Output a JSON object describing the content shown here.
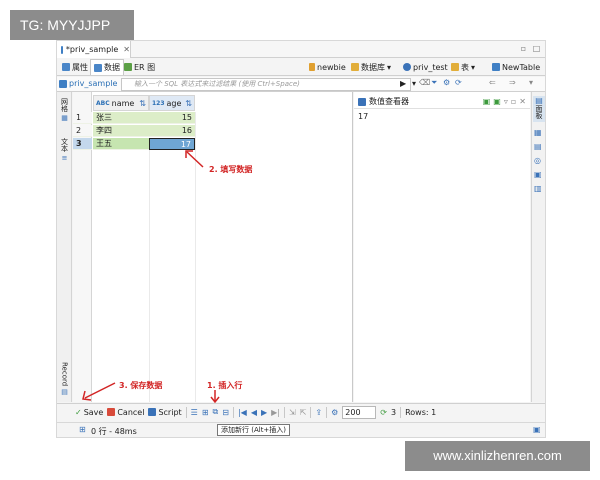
{
  "watermark_top": "TG: MYYJJPP",
  "watermark_bottom": "www.xinlizhenren.com",
  "editor_tab": {
    "title": "*priv_sample",
    "close": "✕"
  },
  "subtabs": [
    {
      "label": "属性"
    },
    {
      "label": "数据"
    },
    {
      "label": "ER 图"
    }
  ],
  "right_tools": {
    "connection": "newbie",
    "database_label": "数据库",
    "schema": "priv_test",
    "table_label": "表",
    "new_table": "NewTable"
  },
  "filter": {
    "table_name": "priv_sample",
    "placeholder": "输入一个 SQL 表达式来过滤结果 (使用 Ctrl+Space)"
  },
  "left_vtabs": {
    "grid": "网格",
    "text": "文本",
    "record": "Record"
  },
  "grid": {
    "columns": [
      {
        "type": "ABC",
        "name": "name"
      },
      {
        "type": "123",
        "name": "age"
      }
    ],
    "rows": [
      {
        "num": "1",
        "name": "张三",
        "age": "15"
      },
      {
        "num": "2",
        "name": "李四",
        "age": "16"
      },
      {
        "num": "3",
        "name": "王五",
        "age": "17"
      }
    ]
  },
  "value_viewer": {
    "title": "数值查看器",
    "value": "17"
  },
  "right_vstrip": {
    "label": "面板"
  },
  "annotations": {
    "fill": "2. 填写数据",
    "insert": "1. 插入行",
    "save": "3. 保存数据"
  },
  "bottom": {
    "save": "Save",
    "cancel": "Cancel",
    "script": "Script",
    "fetch_size": "200",
    "fetched": "3",
    "rows": "Rows: 1",
    "tooltip": "添加新行 (Alt+插入)"
  },
  "status": {
    "text": "0 行 - 48ms"
  },
  "colors": {
    "accent": "#2a6fb5",
    "annotation": "#d22525",
    "row_new": "#dcedc8",
    "row_selected": "#6fa6d4"
  }
}
